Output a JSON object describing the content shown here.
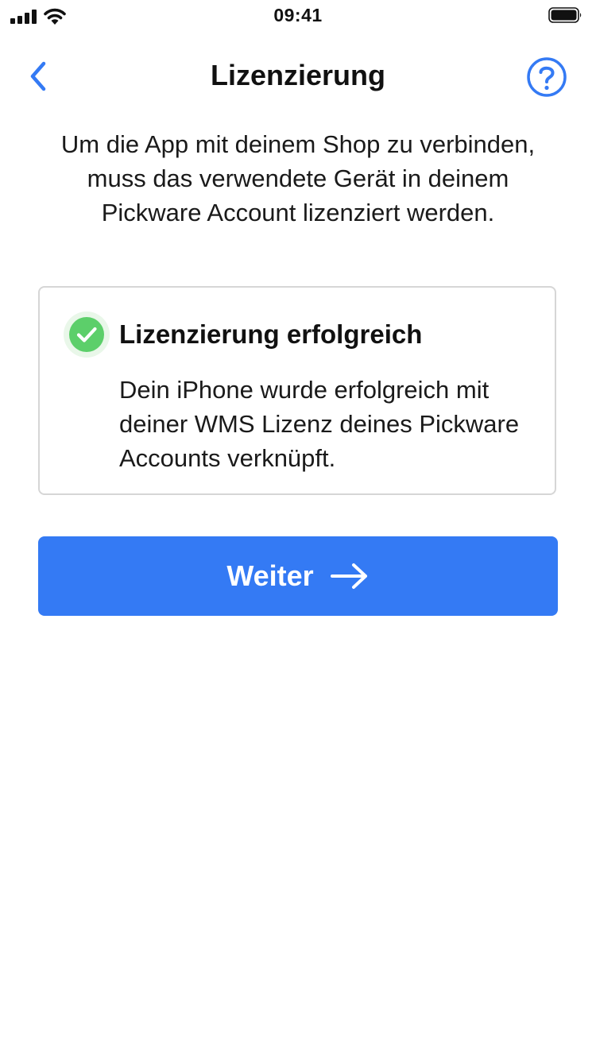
{
  "status_bar": {
    "time": "09:41",
    "signal_icon": "cellular-signal-icon",
    "wifi_icon": "wifi-icon",
    "battery_icon": "battery-icon"
  },
  "navigation": {
    "back_icon": "chevron-left-icon",
    "title": "Lizenzierung",
    "help_icon": "question-circle-icon"
  },
  "intro_text": "Um die App mit deinem Shop zu verbinden, muss das verwendete Gerät in deinem Pickware Account lizenziert werden.",
  "success_card": {
    "icon": "check-circle-icon",
    "title": "Lizenzierung erfolgreich",
    "body": "Dein iPhone wurde erfolgreich mit deiner WMS Lizenz deines Pickware Accounts verknüpft."
  },
  "primary_button": {
    "label": "Weiter",
    "icon": "arrow-right-icon"
  },
  "colors": {
    "accent": "#347af4",
    "success": "#5ccf6a",
    "success_halo": "#e9f7e9",
    "card_border": "#d6d6d6"
  }
}
